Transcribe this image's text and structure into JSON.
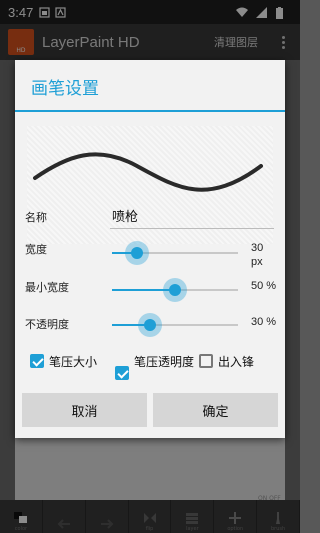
{
  "status_bar": {
    "time": "3:47"
  },
  "action_bar": {
    "app_icon_text": "HD",
    "title": "LayerPaint HD",
    "clear_layer": "清理图层"
  },
  "toolbar": {
    "labels": [
      "color",
      "",
      "",
      "flip",
      "layer",
      "option",
      "brush"
    ],
    "onoff": "ON  OFF"
  },
  "dialog": {
    "title": "画笔设置",
    "name_label": "名称",
    "name_value": "喷枪",
    "width": {
      "label": "宽度",
      "value": "30",
      "unit": "px",
      "fraction": 0.2
    },
    "min_width": {
      "label": "最小宽度",
      "value": "50 %",
      "fraction": 0.5
    },
    "opacity": {
      "label": "不透明度",
      "value": "30 %",
      "fraction": 0.3
    },
    "checks": {
      "pen_pressure_size": {
        "label": "笔压大小",
        "checked": true
      },
      "pen_pressure_opacity": {
        "label": "笔压透明度",
        "checked": true
      },
      "fade_in_out": {
        "label": "出入锋",
        "checked": false
      }
    },
    "cancel": "取消",
    "ok": "确定"
  },
  "colors": {
    "accent": "#1e9fd6"
  }
}
